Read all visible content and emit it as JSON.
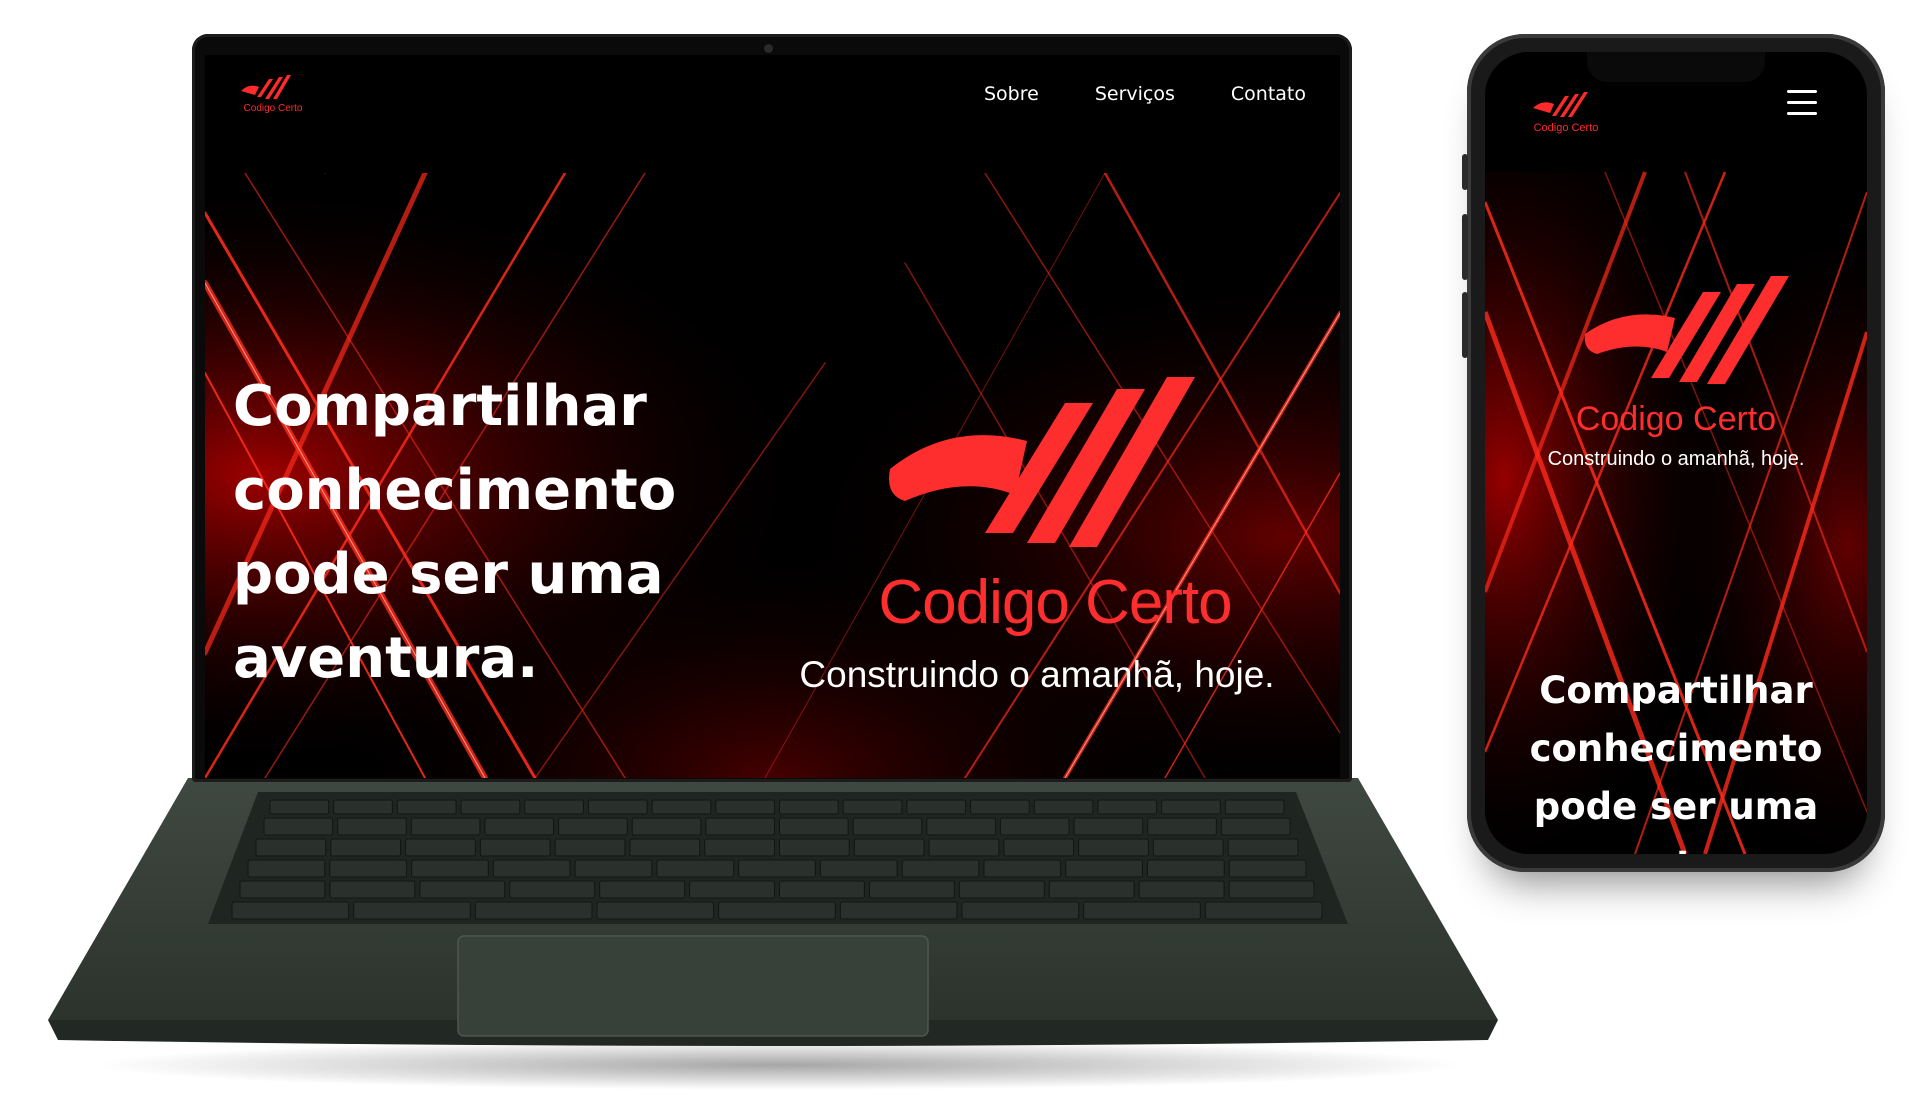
{
  "site": {
    "brand_name": "Codigo Certo",
    "tagline": "Construindo o amanhã, hoje.",
    "accent_color": "#ff2e2e",
    "background_color": "#000000"
  },
  "desktop": {
    "nav": {
      "items": [
        {
          "label": "Sobre"
        },
        {
          "label": "Serviços"
        },
        {
          "label": "Contato"
        }
      ]
    },
    "hero": {
      "headline_lines": [
        "Compartilhar",
        "conhecimento",
        "pode ser uma",
        "aventura."
      ],
      "logo_title": "Codigo Certo",
      "logo_subtitle": "Construindo o amanhã, hoje."
    },
    "header_logo_text": "Codigo Certo"
  },
  "mobile": {
    "header_logo_text": "Codigo Certo",
    "menu_icon": "hamburger-menu-icon",
    "hero": {
      "logo_title": "Codigo Certo",
      "logo_subtitle": "Construindo o amanhã, hoje.",
      "headline_lines": [
        "Compartilhar",
        "conhecimento",
        "pode ser uma",
        "aventura."
      ]
    }
  }
}
